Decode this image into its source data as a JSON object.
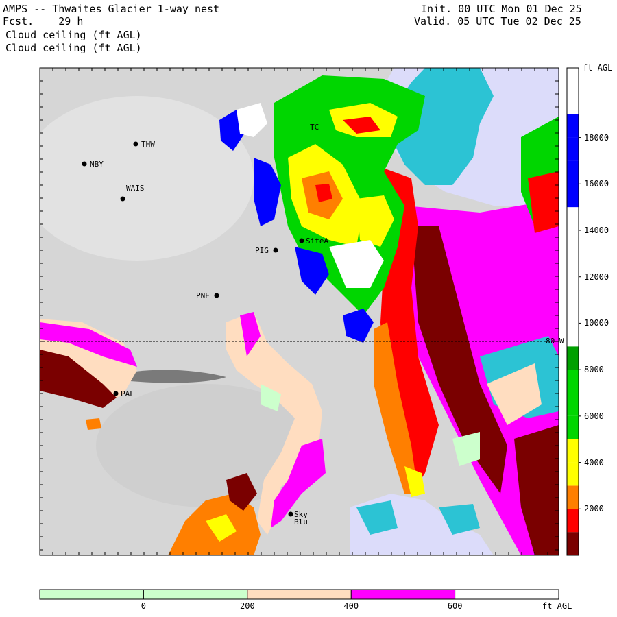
{
  "header": {
    "title": "AMPS -- Thwaites Glacier 1-way nest",
    "forecast": "Fcst.    29 h",
    "field_line_1": "Cloud ceiling (ft AGL)",
    "field_line_2": "Cloud ceiling (ft AGL)",
    "init": "Init. 00 UTC Mon 01 Dec 25",
    "valid": "Valid. 05 UTC Tue 02 Dec 25"
  },
  "map": {
    "latitude_label": "80 W",
    "stations": [
      {
        "id": "THW",
        "label": "THW"
      },
      {
        "id": "NBY",
        "label": "NBY"
      },
      {
        "id": "WAIS",
        "label": "WAIS"
      },
      {
        "id": "PIG",
        "label": "PIG"
      },
      {
        "id": "SiteA",
        "label": "SiteA"
      },
      {
        "id": "PNE",
        "label": "PNE"
      },
      {
        "id": "PAL",
        "label": "PAL"
      },
      {
        "id": "Sky",
        "label": "Sky"
      },
      {
        "id": "Blu",
        "label": "Blu"
      },
      {
        "id": "TC",
        "label": "TC"
      }
    ]
  },
  "vertical_colorbar": {
    "unit": "ft AGL",
    "tick_labels": [
      "2000",
      "4000",
      "6000",
      "8000",
      "10000",
      "12000",
      "14000",
      "16000",
      "18000"
    ],
    "colors": [
      "#7a0000",
      "#ff0000",
      "#ff7f00",
      "#ffff00",
      "#ffff00",
      "#00d600",
      "#00d600",
      "#00d600",
      "#00a000",
      "#ffffff",
      "#ffffff",
      "#ffffff",
      "#ffffff",
      "#ffffff",
      "#ffffff",
      "#0000ff",
      "#0000ff",
      "#0000ff",
      "#0000ff",
      "#ffffff",
      "#ffffff"
    ]
  },
  "horizontal_colorbar": {
    "unit": "ft AGL",
    "tick_labels": [
      "0",
      "200",
      "400",
      "600"
    ],
    "colors": [
      "#ccffcc",
      "#ccffcc",
      "#ffddc0",
      "#ff00ff",
      "#ffffff"
    ]
  },
  "colors": {
    "terrain_gray": "#d6d6d6",
    "ocean_cyan": "#2cc3d4",
    "ice_lavender": "#dcdcfa",
    "low_green": "#ccffcc",
    "peach": "#ffddc0",
    "magenta": "#ff00ff",
    "dark_red": "#7a0000",
    "red": "#ff0000",
    "orange": "#ff7f00",
    "yellow": "#ffff00",
    "green": "#00d600",
    "blue": "#0000ff"
  }
}
